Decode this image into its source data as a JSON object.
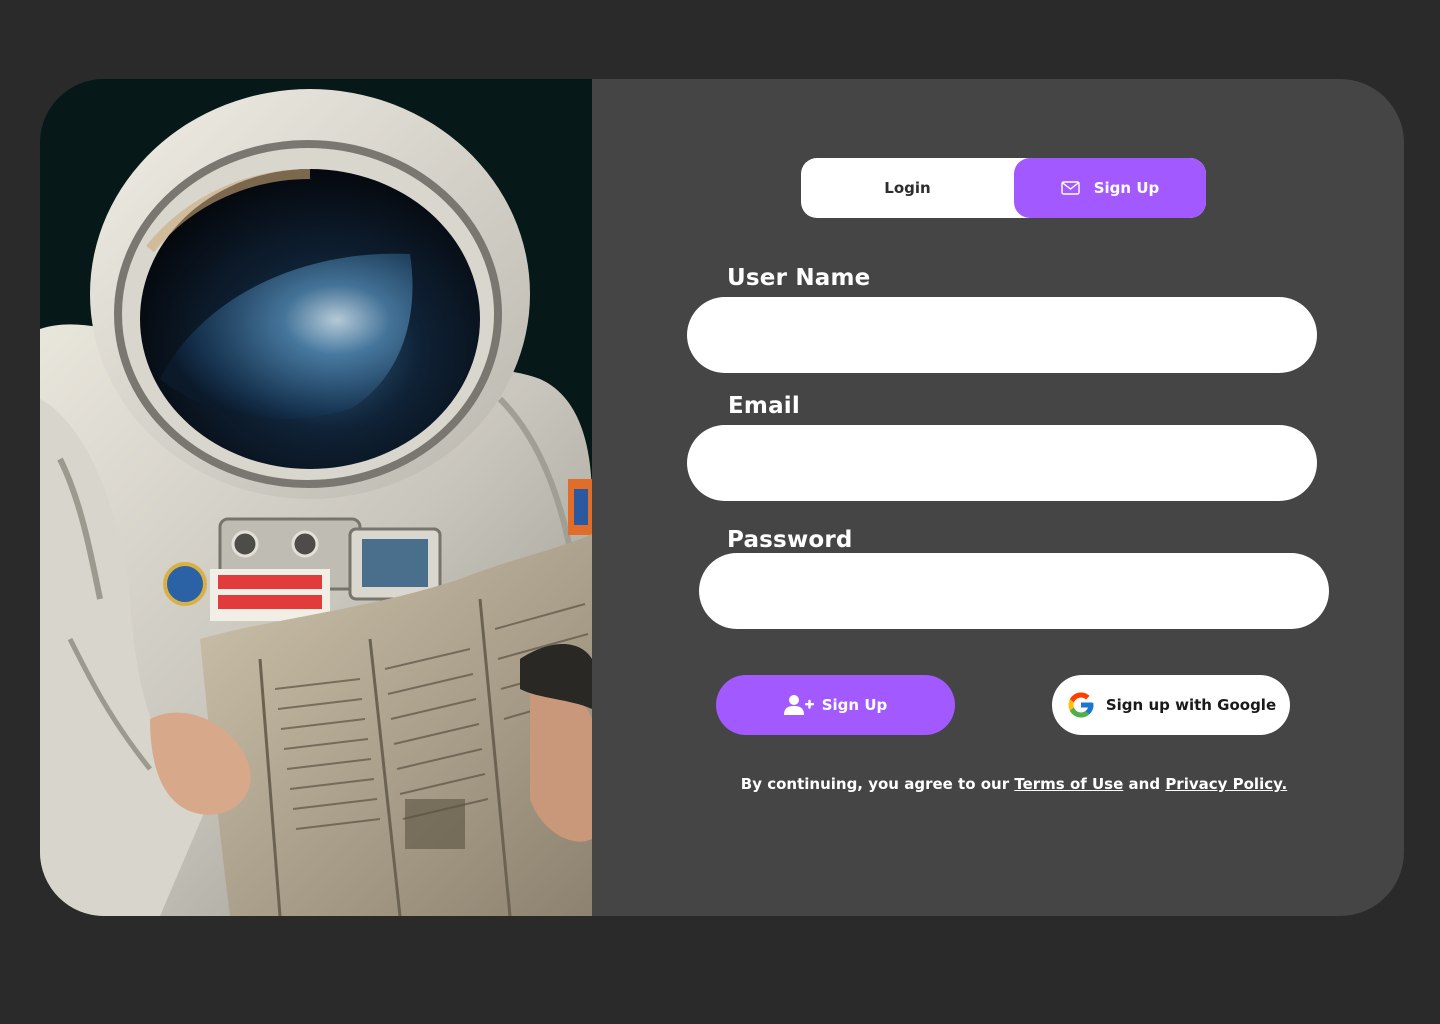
{
  "colors": {
    "page_background": "#2a2a2a",
    "panel_background": "#454545",
    "accent": "#a259ff",
    "input_background": "#ffffff"
  },
  "hero_image": {
    "description_icon": "astronaut-reading-newspaper-image"
  },
  "tabs": {
    "login_label": "Login",
    "signup_label": "Sign Up",
    "signup_icon": "envelope-icon",
    "active": "signup"
  },
  "form": {
    "username": {
      "label": "User Name",
      "value": "",
      "placeholder": ""
    },
    "email": {
      "label": "Email",
      "value": "",
      "placeholder": ""
    },
    "password": {
      "label": "Password",
      "value": "",
      "placeholder": ""
    }
  },
  "actions": {
    "signup_label": "Sign Up",
    "signup_icon": "user-plus-icon",
    "google_label": "Sign up with Google",
    "google_icon": "google-icon"
  },
  "legal": {
    "prefix": "By continuing, you agree to our",
    "terms_link": "Terms of Use",
    "conjunction": "and",
    "privacy_link": "Privacy Policy."
  }
}
